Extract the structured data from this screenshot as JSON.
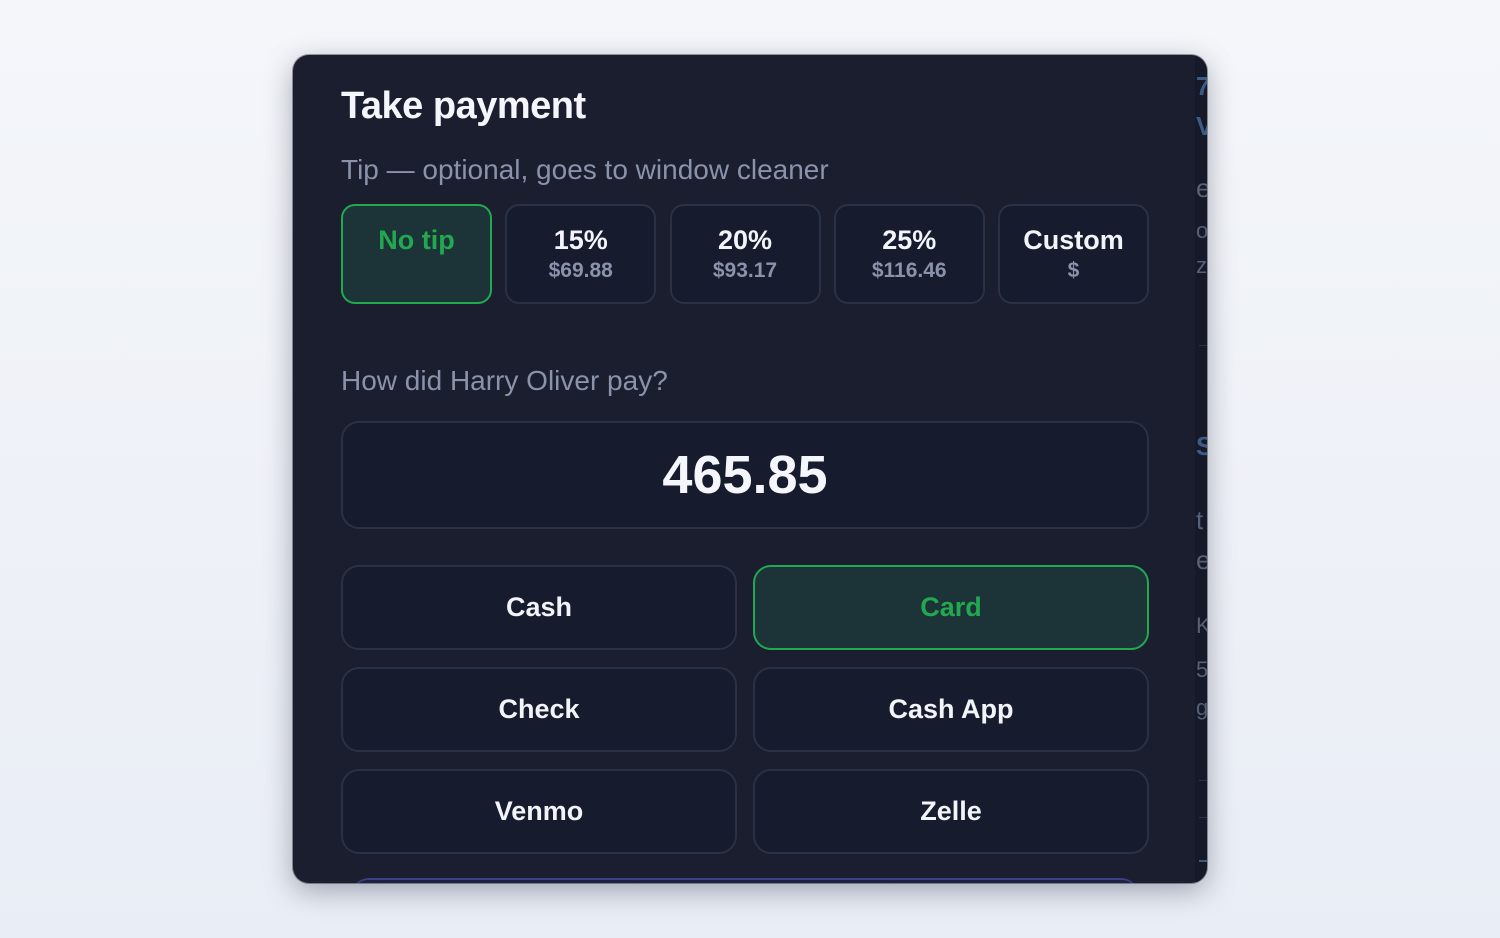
{
  "modal": {
    "title": "Take payment",
    "tip_label": "Tip — optional, goes to window cleaner",
    "tips": [
      {
        "label": "No tip",
        "amount": "",
        "selected": true
      },
      {
        "label": "15%",
        "amount": "$69.88",
        "selected": false
      },
      {
        "label": "20%",
        "amount": "$93.17",
        "selected": false
      },
      {
        "label": "25%",
        "amount": "$116.46",
        "selected": false
      },
      {
        "label": "Custom",
        "amount": "$",
        "selected": false
      }
    ],
    "pay_question": "How did Harry Oliver pay?",
    "amount_value": "465.85",
    "methods": [
      {
        "label": "Cash",
        "selected": false
      },
      {
        "label": "Card",
        "selected": true
      },
      {
        "label": "Check",
        "selected": false
      },
      {
        "label": "Cash App",
        "selected": false
      },
      {
        "label": "Venmo",
        "selected": false
      },
      {
        "label": "Zelle",
        "selected": false
      }
    ]
  },
  "colors": {
    "modal_bg": "#1a1e2e",
    "button_bg": "#161b2e",
    "border": "#2b3144",
    "accent_green": "#22a94f",
    "selected_bg": "#1c3438",
    "muted_text": "#8a93ab",
    "primary_text": "#f4f6fb"
  }
}
